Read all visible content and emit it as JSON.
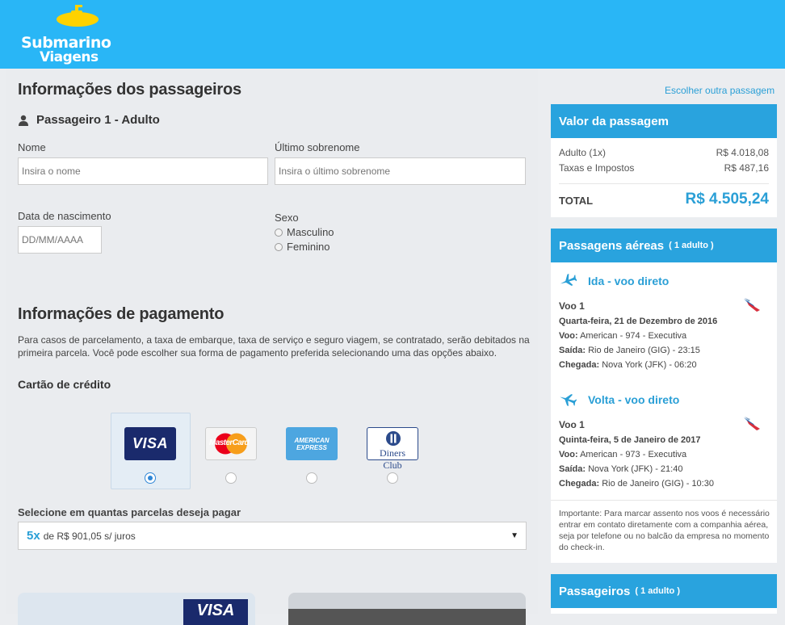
{
  "header": {
    "logo_line1": "Submarino",
    "logo_line2": "Viagens",
    "brand_color": "#29b6f6"
  },
  "passengers": {
    "title": "Informações dos passageiros",
    "passenger_heading": "Passageiro 1 - Adulto",
    "name_label": "Nome",
    "name_placeholder": "Insira o nome",
    "surname_label": "Último sobrenome",
    "surname_placeholder": "Insira o último sobrenome",
    "birth_label": "Data de nascimento",
    "birth_placeholder": "DD/MM/AAAA",
    "sex_label": "Sexo",
    "sex_options": [
      "Masculino",
      "Feminino"
    ]
  },
  "payment": {
    "title": "Informações de pagamento",
    "description": "Para casos de parcelamento, a taxa de embarque, taxa de serviço e seguro viagem, se contratado, serão debitados na primeira parcela. Você pode escolher sua forma de pagamento preferida selecionando uma das opções abaixo.",
    "credit_card_title": "Cartão de crédito",
    "cards": [
      "VISA",
      "MasterCard",
      "AMERICAN EXPRESS",
      "Diners Club"
    ],
    "selected_card": "VISA",
    "installments_label": "Selecione em quantas parcelas deseja pagar",
    "installments_count": "5x",
    "installments_text": "de R$ 901,05 s/ juros"
  },
  "sidebar": {
    "other_link": "Escolher outra passagem",
    "price_panel": {
      "title": "Valor da passagem",
      "rows": [
        {
          "label": "Adulto (1x)",
          "value": "R$ 4.018,08"
        },
        {
          "label": "Taxas e Impostos",
          "value": "R$ 487,16"
        }
      ],
      "total_label": "TOTAL",
      "total_value": "R$ 4.505,24"
    },
    "flights_panel": {
      "title": "Passagens aéreas",
      "subtitle": "( 1 adulto )",
      "legs": [
        {
          "title": "Ida - voo direto",
          "flight": "Voo 1",
          "date": "Quarta-feira, 21 de Dezembro de 2016",
          "voo_label": "Voo:",
          "voo": "American - 974 - Executiva",
          "saida_label": "Saída:",
          "saida": "Rio de Janeiro (GIG) - 23:15",
          "chegada_label": "Chegada:",
          "chegada": "Nova York (JFK) - 06:20"
        },
        {
          "title": "Volta - voo direto",
          "flight": "Voo 1",
          "date": "Quinta-feira, 5 de Janeiro de 2017",
          "voo_label": "Voo:",
          "voo": "American - 973 - Executiva",
          "saida_label": "Saída:",
          "saida": "Nova York (JFK) - 21:40",
          "chegada_label": "Chegada:",
          "chegada": "Rio de Janeiro (GIG) - 10:30"
        }
      ],
      "note": "Importante: Para marcar assento nos voos é necessário entrar em contato diretamente com a companhia aérea, seja por telefone ou no balcão da empresa no momento do check-in."
    },
    "passengers_panel": {
      "title": "Passageiros",
      "subtitle": "( 1 adulto )"
    }
  }
}
